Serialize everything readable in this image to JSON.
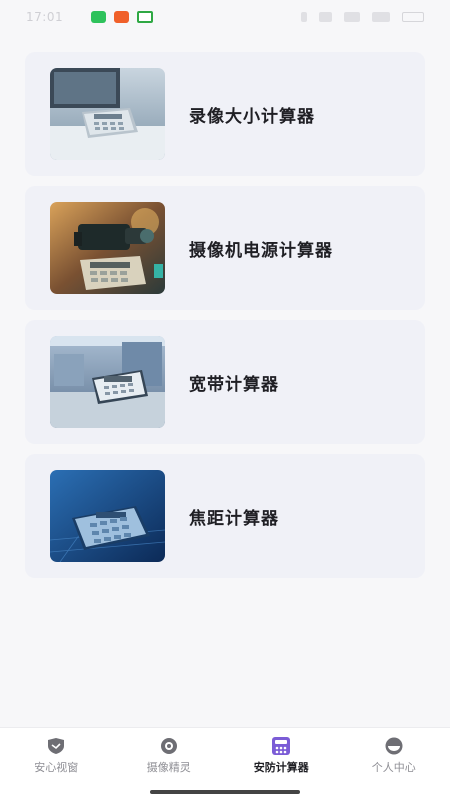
{
  "status_bar": {
    "time": "17:01"
  },
  "cards": [
    {
      "title": "录像大小计算器"
    },
    {
      "title": "摄像机电源计算器"
    },
    {
      "title": "宽带计算器"
    },
    {
      "title": "焦距计算器"
    }
  ],
  "bottom_nav": {
    "items": [
      {
        "label": "安心视窗"
      },
      {
        "label": "摄像精灵"
      },
      {
        "label": "安防计算器"
      },
      {
        "label": "个人中心"
      }
    ],
    "active_index": 2
  },
  "colors": {
    "accent": "#7b5cd6",
    "card_bg": "#f0f1f7",
    "page_bg": "#f7f7f9"
  }
}
